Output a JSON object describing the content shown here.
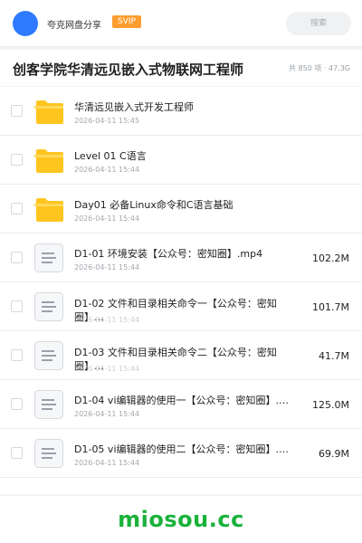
{
  "header": {
    "app_name": "夸克网盘分享",
    "badge": "SVIP",
    "search_placeholder": "搜索"
  },
  "folder": {
    "title": "创客学院华清远见嵌入式物联网工程师",
    "meta": "共 850 项 · 47.3G"
  },
  "items": [
    {
      "type": "folder",
      "name": "华清远见嵌入式开发工程师",
      "date": "2026-04-11 15:45",
      "size": ""
    },
    {
      "type": "folder",
      "name": "Level 01 C语言",
      "date": "2026-04-11 15:44",
      "size": ""
    },
    {
      "type": "folder",
      "name": "Day01 必备Linux命令和C语言基础",
      "date": "2026-04-11 15:44",
      "size": ""
    },
    {
      "type": "file",
      "name": "D1-01 环境安装【公众号：密知圈】.mp4",
      "date": "2026-04-11 15:44",
      "size": "102.2M"
    },
    {
      "type": "file",
      "name": "D1-02 文件和目录相关命令一【公众号：密知圈】…",
      "date": "2026-04-11 15:44",
      "size": "101.7M"
    },
    {
      "type": "file",
      "name": "D1-03 文件和目录相关命令二【公众号：密知圈】…",
      "date": "2026-04-11 15:44",
      "size": "41.7M"
    },
    {
      "type": "file",
      "name": "D1-04 vi编辑器的使用一【公众号：密知圈】.…",
      "date": "2026-04-11 15:44",
      "size": "125.0M"
    },
    {
      "type": "file",
      "name": "D1-05 vi编辑器的使用二【公众号：密知圈】.…",
      "date": "2026-04-11 15:44",
      "size": "69.9M"
    }
  ],
  "watermark": "miosou.cc",
  "colors": {
    "logo": "#2f7bff",
    "svip": "#ff9d2e",
    "folder_icon": "#ffc51f",
    "watermark": "#19b23b"
  }
}
